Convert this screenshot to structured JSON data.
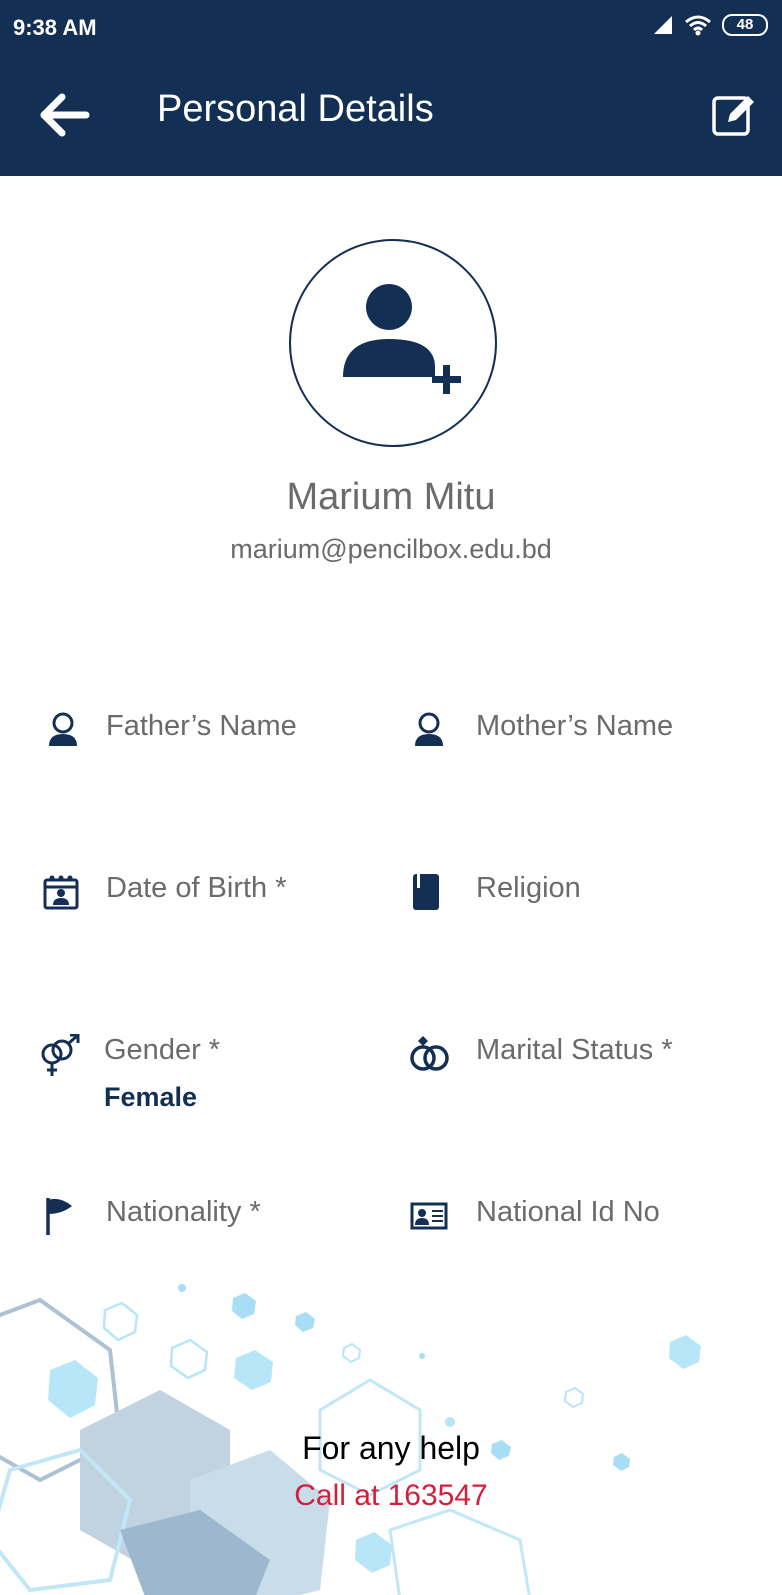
{
  "status_bar": {
    "time": "9:38 AM",
    "battery": "48"
  },
  "app_bar": {
    "title": "Personal Details",
    "back_icon": "arrow-left-icon",
    "edit_icon": "edit-icon"
  },
  "profile": {
    "name": "Marium Mitu",
    "email": "marium@pencilbox.edu.bd",
    "avatar_icon": "add-user-icon"
  },
  "fields": {
    "fathers_name": {
      "label": "Father’s Name",
      "icon": "person-icon"
    },
    "mothers_name": {
      "label": "Mother’s Name",
      "icon": "person-icon"
    },
    "date_of_birth": {
      "label": "Date of Birth *",
      "icon": "calendar-icon"
    },
    "religion": {
      "label": "Religion",
      "icon": "book-icon"
    },
    "gender": {
      "label": "Gender *",
      "value": "Female",
      "icon": "gender-icon"
    },
    "marital_status": {
      "label": "Marital Status *",
      "icon": "rings-icon"
    },
    "nationality": {
      "label": "Nationality *",
      "icon": "flag-icon"
    },
    "national_id": {
      "label": "National Id No",
      "icon": "id-card-icon"
    }
  },
  "help": {
    "title": "For any help",
    "call": "Call at 163547"
  },
  "colors": {
    "primary": "#142f54",
    "text": "#6b6b6b",
    "accent_red": "#d31f3a",
    "hex_decor": "#8fd3f0"
  }
}
